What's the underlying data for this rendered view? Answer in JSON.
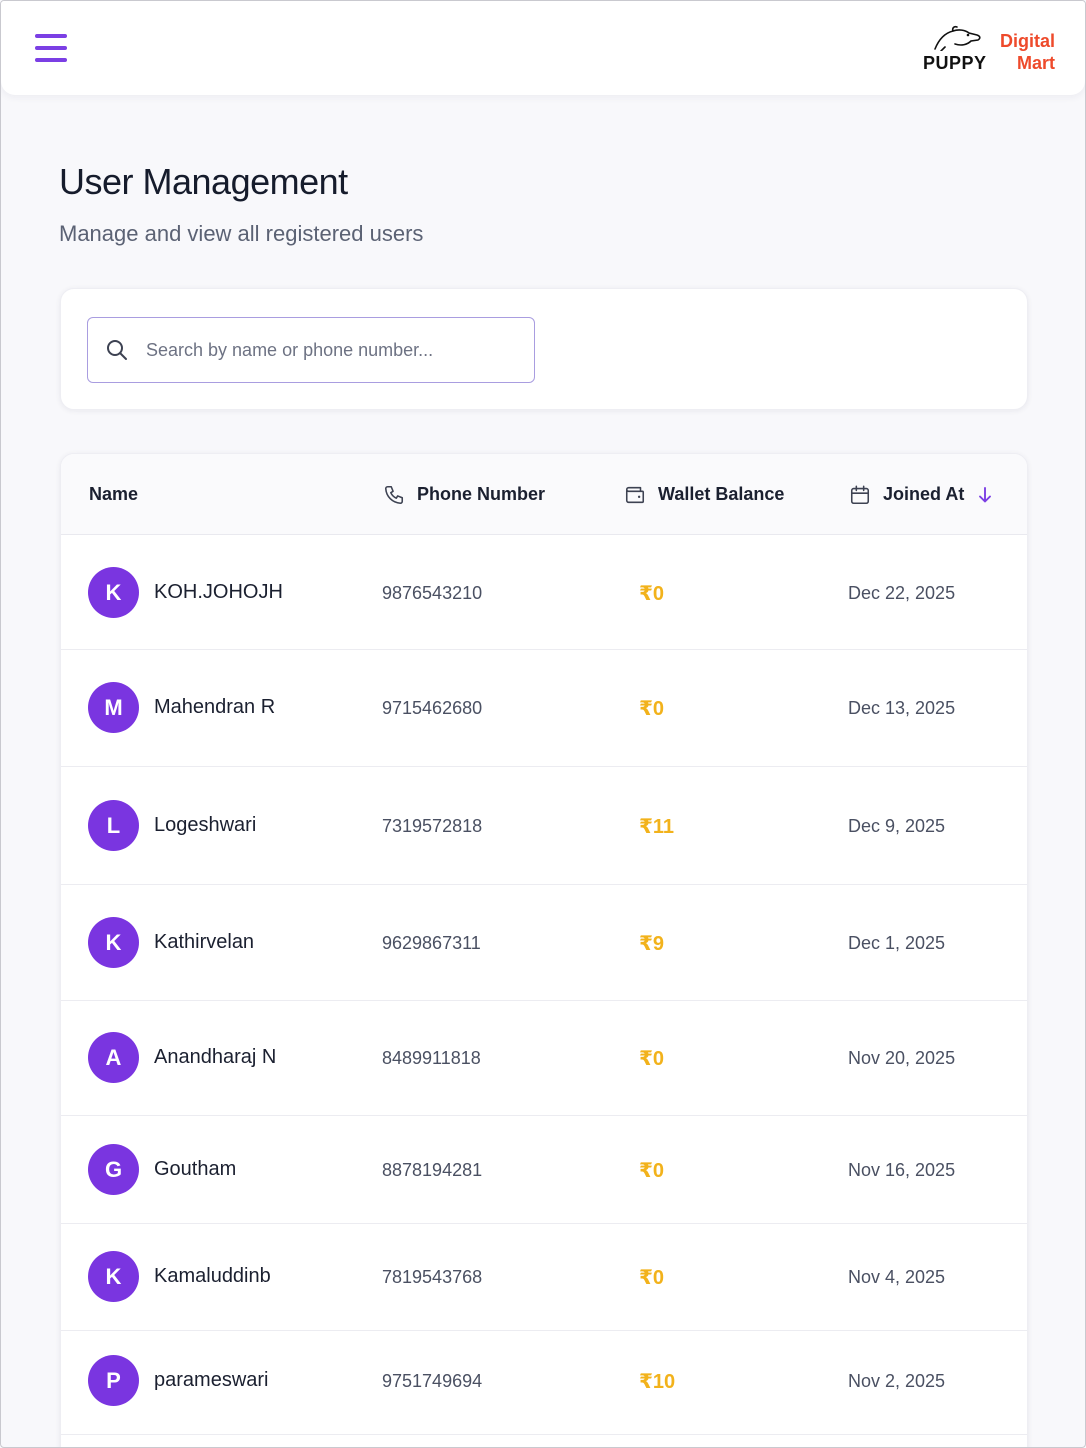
{
  "header": {
    "menu_icon": "hamburger-menu-icon",
    "logo": {
      "brand": "PUPPY",
      "digital": "Digital",
      "mart": "Mart",
      "accent": "#ee4a2b"
    }
  },
  "page": {
    "title": "User Management",
    "subtitle": "Manage and view all registered users"
  },
  "search": {
    "placeholder": "Search by name or phone number...",
    "value": "",
    "icon": "search-icon"
  },
  "table": {
    "columns": {
      "name": "Name",
      "phone": "Phone Number",
      "wallet": "Wallet Balance",
      "joined": "Joined At"
    },
    "sort": {
      "column": "joined",
      "direction": "desc"
    },
    "rows": [
      {
        "initial": "K",
        "name": "KOH.JOHOJH",
        "phone": "9876543210",
        "wallet": "₹0",
        "joined": "Dec 22, 2025"
      },
      {
        "initial": "M",
        "name": "Mahendran R",
        "phone": "9715462680",
        "wallet": "₹0",
        "joined": "Dec 13, 2025"
      },
      {
        "initial": "L",
        "name": "Logeshwari",
        "phone": "7319572818",
        "wallet": "₹11",
        "joined": "Dec 9, 2025"
      },
      {
        "initial": "K",
        "name": "Kathirvelan",
        "phone": "9629867311",
        "wallet": "₹9",
        "joined": "Dec 1, 2025"
      },
      {
        "initial": "A",
        "name": "Anandharaj N",
        "phone": "8489911818",
        "wallet": "₹0",
        "joined": "Nov 20, 2025"
      },
      {
        "initial": "G",
        "name": "Goutham",
        "phone": "8878194281",
        "wallet": "₹0",
        "joined": "Nov 16, 2025"
      },
      {
        "initial": "K",
        "name": "Kamaluddinb",
        "phone": "7819543768",
        "wallet": "₹0",
        "joined": "Nov 4, 2025"
      },
      {
        "initial": "P",
        "name": "parameswari",
        "phone": "9751749694",
        "wallet": "₹10",
        "joined": "Nov 2, 2025"
      }
    ]
  },
  "colors": {
    "accent": "#7b3fe4",
    "avatar": "#7a35e0",
    "wallet": "#f2b21b"
  }
}
